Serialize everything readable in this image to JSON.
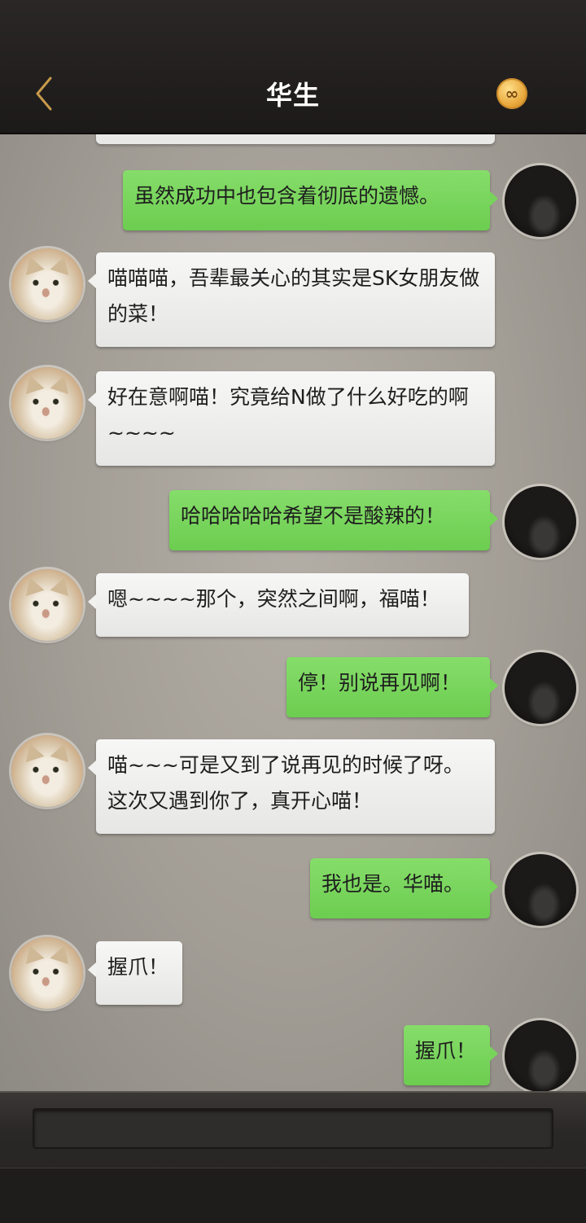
{
  "header": {
    "title": "华生",
    "back_icon": "chevron-left-icon",
    "coin_icon": "infinity-coin-icon",
    "coin_symbol": "∞",
    "accent_color": "#c79a4a"
  },
  "messages": [
    {
      "side": "right",
      "text": "虽然成功中也包含着彻底的遗憾。"
    },
    {
      "side": "left",
      "text": "喵喵喵，吾辈最关心的其实是SK女朋友做的菜！"
    },
    {
      "side": "left",
      "text": "好在意啊喵！究竟给N做了什么好吃的啊~~~~"
    },
    {
      "side": "right",
      "text": "哈哈哈哈哈希望不是酸辣的！"
    },
    {
      "side": "left",
      "text": "嗯~~~~那个，突然之间啊，福喵！"
    },
    {
      "side": "right",
      "text": "停！别说再见啊！"
    },
    {
      "side": "left",
      "text": "喵~~~可是又到了说再见的时候了呀。这次又遇到你了，真开心喵！"
    },
    {
      "side": "right",
      "text": "我也是。华喵。"
    },
    {
      "side": "left",
      "text": "握爪！"
    },
    {
      "side": "right",
      "text": "握爪！"
    }
  ],
  "input": {
    "value": "",
    "placeholder": ""
  },
  "colors": {
    "outgoing_bubble": "#78d35b",
    "incoming_bubble": "#f1f1ef"
  }
}
